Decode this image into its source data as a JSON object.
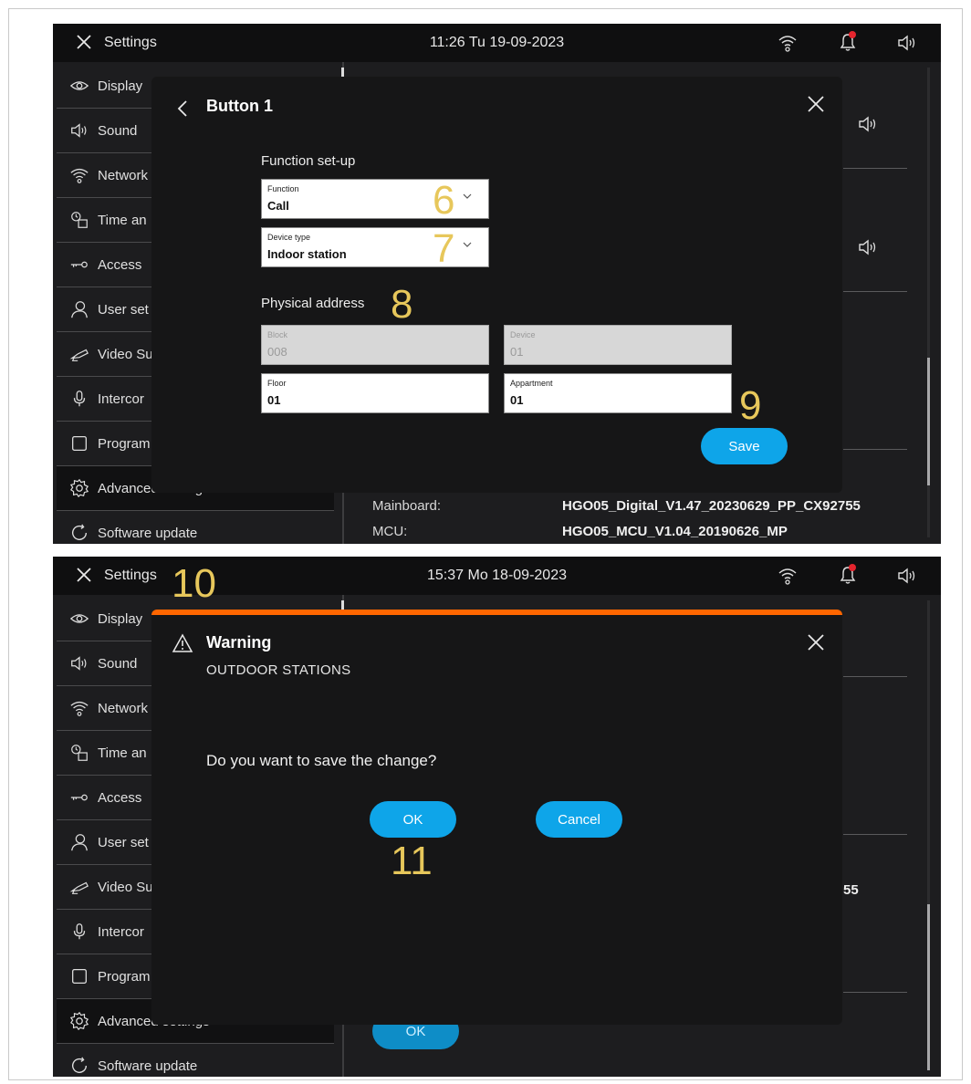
{
  "screens": [
    {
      "topbar": {
        "title": "Settings",
        "datetime": "11:26  Tu 19-09-2023"
      },
      "sidebar": [
        {
          "label": "Display",
          "icon": "eye-icon"
        },
        {
          "label": "Sound",
          "icon": "speaker-icon"
        },
        {
          "label": "Network",
          "icon": "wifi-icon"
        },
        {
          "label": "Time an",
          "icon": "clock-calendar-icon"
        },
        {
          "label": "Access",
          "icon": "key-icon"
        },
        {
          "label": "User set",
          "icon": "user-icon"
        },
        {
          "label": "Video Su",
          "icon": "camera-icon"
        },
        {
          "label": "Intercor",
          "icon": "microphone-icon"
        },
        {
          "label": "Program",
          "icon": "square-icon"
        },
        {
          "label": "Advanced settings",
          "icon": "gear-icon"
        },
        {
          "label": "Software update",
          "icon": "refresh-icon"
        }
      ],
      "info": [
        {
          "label": "Mainboard:",
          "value": "HGO05_Digital_V1.47_20230629_PP_CX92755"
        },
        {
          "label": "MCU:",
          "value": "HGO05_MCU_V1.04_20190626_MP"
        }
      ],
      "dialog": {
        "title": "Button 1",
        "function_section": "Function set-up",
        "function_label": "Function",
        "function_value": "Call",
        "device_type_label": "Device type",
        "device_type_value": "Indoor station",
        "address_section": "Physical address",
        "block_label": "Block",
        "block_value": "008",
        "device_label": "Device",
        "device_value": "01",
        "floor_label": "Floor",
        "floor_value": "01",
        "apartment_label": "Appartment",
        "apartment_value": "01",
        "save_label": "Save"
      },
      "callouts": [
        "6",
        "7",
        "8",
        "9"
      ]
    },
    {
      "topbar": {
        "title": "Settings",
        "datetime": "15:37  Mo 18-09-2023"
      },
      "sidebar": [
        {
          "label": "Display",
          "icon": "eye-icon"
        },
        {
          "label": "Sound",
          "icon": "speaker-icon"
        },
        {
          "label": "Network",
          "icon": "wifi-icon"
        },
        {
          "label": "Time an",
          "icon": "clock-calendar-icon"
        },
        {
          "label": "Access",
          "icon": "key-icon"
        },
        {
          "label": "User set",
          "icon": "user-icon"
        },
        {
          "label": "Video Su",
          "icon": "camera-icon"
        },
        {
          "label": "Intercor",
          "icon": "microphone-icon"
        },
        {
          "label": "Program",
          "icon": "square-icon"
        },
        {
          "label": "Advanced settings",
          "icon": "gear-icon"
        },
        {
          "label": "Software update",
          "icon": "refresh-icon"
        }
      ],
      "background": {
        "partial_value": "55",
        "ok_label": "OK"
      },
      "dialog": {
        "title": "Warning",
        "subtitle": "OUTDOOR STATIONS",
        "question": "Do you want to save the change?",
        "ok_label": "OK",
        "cancel_label": "Cancel"
      },
      "callouts": [
        "10",
        "11"
      ]
    }
  ],
  "colors": {
    "accent_button": "#0ea5e9",
    "warning_bar": "#ff6600",
    "callout": "#e7c75b",
    "notification_dot": "#e5252e"
  }
}
